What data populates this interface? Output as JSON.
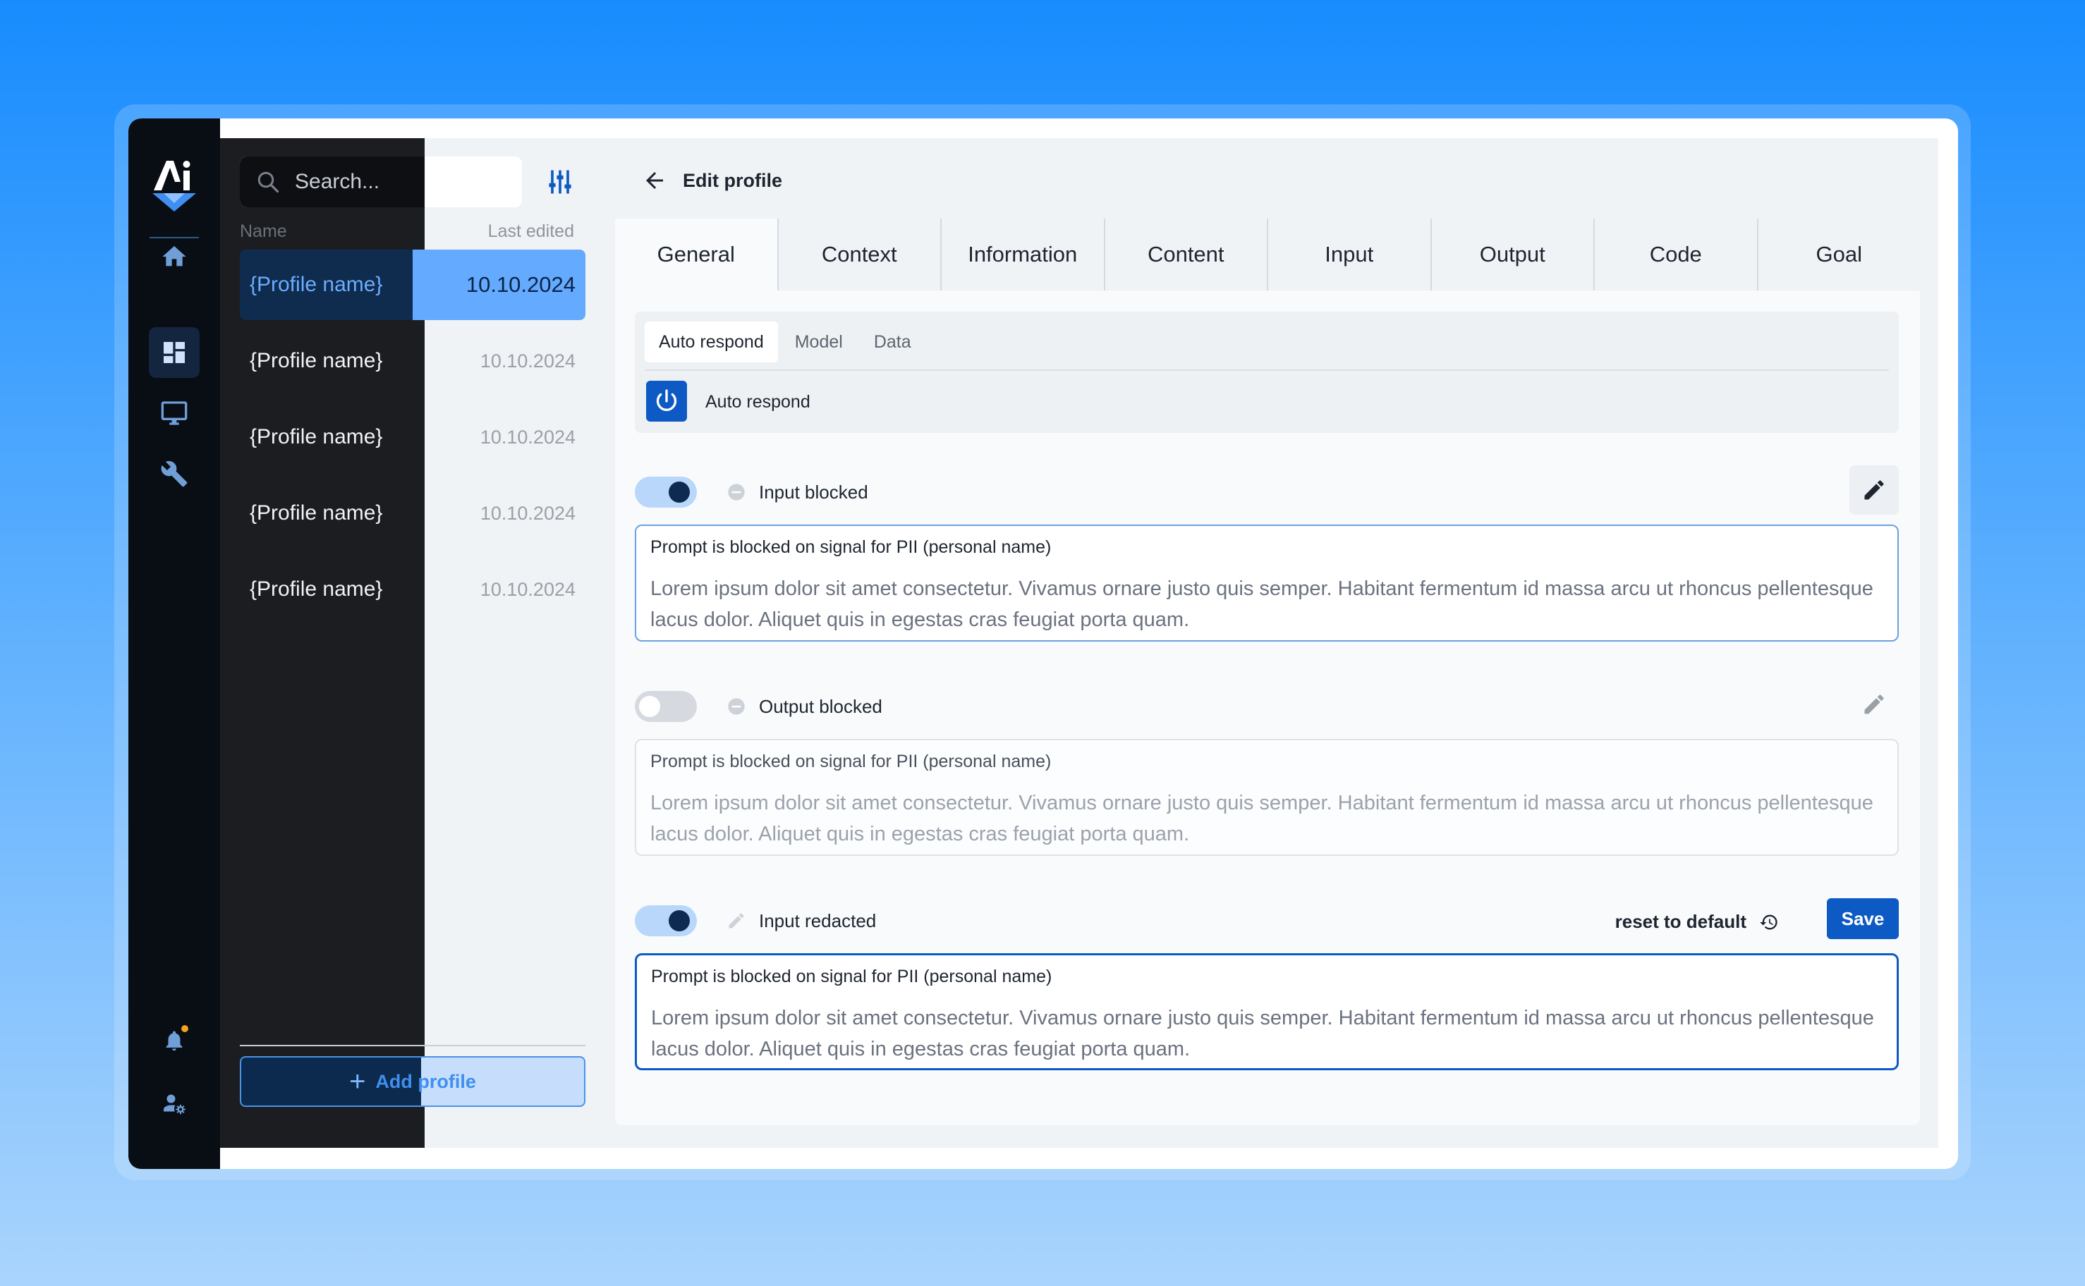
{
  "app": {
    "logo_text": "Ai"
  },
  "rail": {
    "items": [
      {
        "icon": "home-icon"
      },
      {
        "icon": "dashboard-icon",
        "active": true
      },
      {
        "icon": "monitor-icon"
      },
      {
        "icon": "tools-icon"
      }
    ],
    "bottom": [
      {
        "icon": "bell-icon",
        "has_notification": true
      },
      {
        "icon": "user-settings-icon"
      }
    ]
  },
  "profiles": {
    "search_placeholder": "Search...",
    "columns": {
      "name": "Name",
      "date": "Last edited"
    },
    "items": [
      {
        "name": "{Profile name}",
        "date": "10.10.2024",
        "selected": true
      },
      {
        "name": "{Profile name}",
        "date": "10.10.2024"
      },
      {
        "name": "{Profile name}",
        "date": "10.10.2024"
      },
      {
        "name": "{Profile name}",
        "date": "10.10.2024"
      },
      {
        "name": "{Profile name}",
        "date": "10.10.2024"
      }
    ],
    "add_label": "Add profile"
  },
  "editor": {
    "back_label": "Edit profile",
    "tabs": [
      "General",
      "Context",
      "Information",
      "Content",
      "Input",
      "Output",
      "Code",
      "Goal"
    ],
    "active_tab": "General",
    "subtabs": [
      "Auto respond",
      "Model",
      "Data"
    ],
    "active_subtab": "Auto respond",
    "auto_respond_label": "Auto respond",
    "rules": [
      {
        "label": "Input blocked",
        "enabled": true,
        "title": "Prompt is blocked on signal for PII (personal name)",
        "text": "Lorem ipsum dolor sit amet consectetur. Vivamus ornare justo quis semper. Habitant fermentum id massa arcu ut rhoncus pellentesque lacus dolor. Aliquet quis in egestas cras feugiat porta quam."
      },
      {
        "label": "Output blocked",
        "enabled": false,
        "title": "Prompt is blocked on signal for PII (personal name)",
        "text": "Lorem ipsum dolor sit amet consectetur. Vivamus ornare justo quis semper. Habitant fermentum id massa arcu ut rhoncus pellentesque lacus dolor. Aliquet quis in egestas cras feugiat porta quam."
      },
      {
        "label": "Input redacted",
        "enabled": true,
        "title": "Prompt is blocked on signal for PII (personal name)",
        "text": "Lorem ipsum dolor sit amet consectetur. Vivamus ornare justo quis semper. Habitant fermentum id massa arcu ut rhoncus pellentesque lacus dolor. Aliquet quis in egestas cras feugiat porta quam."
      }
    ],
    "reset_label": "reset to default",
    "save_label": "Save"
  },
  "colors": {
    "accent": "#0d5ac4",
    "selected_row": "#64aaff",
    "rail_bg": "#090d14",
    "background_top": "#188cfe",
    "background_bottom": "#a9d4fd"
  }
}
